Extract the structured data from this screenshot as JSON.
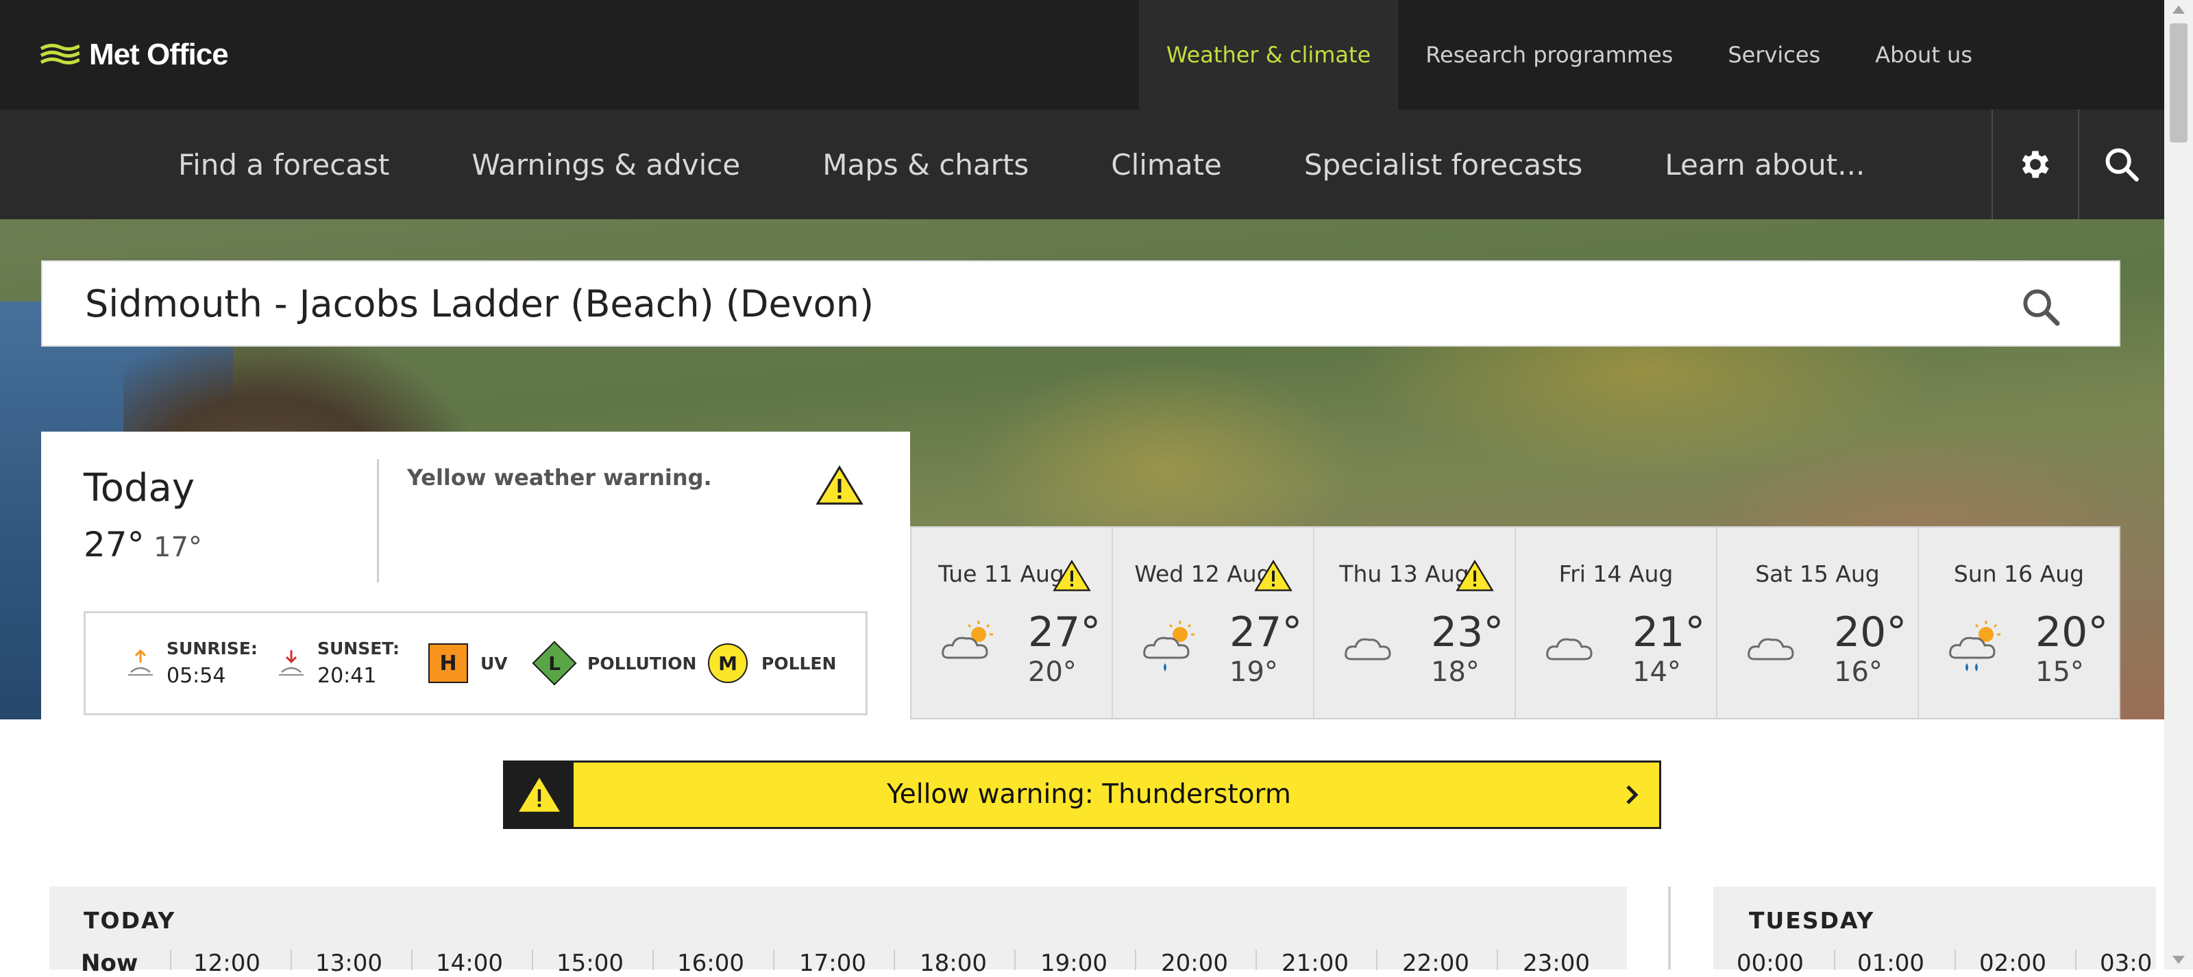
{
  "brand": {
    "name": "Met Office"
  },
  "topnav": {
    "items": [
      {
        "label": "Weather & climate",
        "active": true
      },
      {
        "label": "Research programmes"
      },
      {
        "label": "Services"
      },
      {
        "label": "About us"
      }
    ]
  },
  "subnav": {
    "items": [
      {
        "label": "Find a forecast"
      },
      {
        "label": "Warnings & advice"
      },
      {
        "label": "Maps & charts"
      },
      {
        "label": "Climate"
      },
      {
        "label": "Specialist forecasts"
      },
      {
        "label": "Learn about..."
      }
    ],
    "tools": [
      "gear-icon",
      "search-icon"
    ]
  },
  "location": {
    "value": "Sidmouth - Jacobs Ladder (Beach) (Devon)"
  },
  "today": {
    "title": "Today",
    "high": "27°",
    "low": "17°",
    "warning_text": "Yellow weather warning.",
    "sunrise_label": "SUNRISE:",
    "sunrise_time": "05:54",
    "sunset_label": "SUNSET:",
    "sunset_time": "20:41",
    "uv_level": "H",
    "uv_label": "UV",
    "pollution_level": "L",
    "pollution_label": "POLLUTION",
    "pollen_level": "M",
    "pollen_label": "POLLEN"
  },
  "days": [
    {
      "name": "Tue 11 Aug",
      "high": "27°",
      "low": "20°",
      "warning": true,
      "icon": "sunny-intervals-icon"
    },
    {
      "name": "Wed 12 Aug",
      "high": "27°",
      "low": "19°",
      "warning": true,
      "icon": "light-rain-shower-icon"
    },
    {
      "name": "Thu 13 Aug",
      "high": "23°",
      "low": "18°",
      "warning": true,
      "icon": "cloudy-icon"
    },
    {
      "name": "Fri 14 Aug",
      "high": "21°",
      "low": "14°",
      "warning": false,
      "icon": "cloudy-icon"
    },
    {
      "name": "Sat 15 Aug",
      "high": "20°",
      "low": "16°",
      "warning": false,
      "icon": "cloudy-icon"
    },
    {
      "name": "Sun 16 Aug",
      "high": "20°",
      "low": "15°",
      "warning": false,
      "icon": "heavy-rain-shower-icon"
    }
  ],
  "warning_banner": {
    "text": "Yellow warning: Thunderstorm"
  },
  "hourly": {
    "today_label": "TODAY",
    "today_hours": [
      "Now",
      "12:00",
      "13:00",
      "14:00",
      "15:00",
      "16:00",
      "17:00",
      "18:00",
      "19:00",
      "20:00",
      "21:00",
      "22:00",
      "23:00"
    ],
    "tuesday_label": "TUESDAY",
    "tuesday_hours": [
      "00:00",
      "01:00",
      "02:00",
      "03:0"
    ]
  },
  "colors": {
    "accent": "#c5dd3f",
    "warning_yellow": "#fde629",
    "uv_high": "#f7941d",
    "pollution_low": "#5aa546",
    "pollen_moderate": "#fde629"
  }
}
